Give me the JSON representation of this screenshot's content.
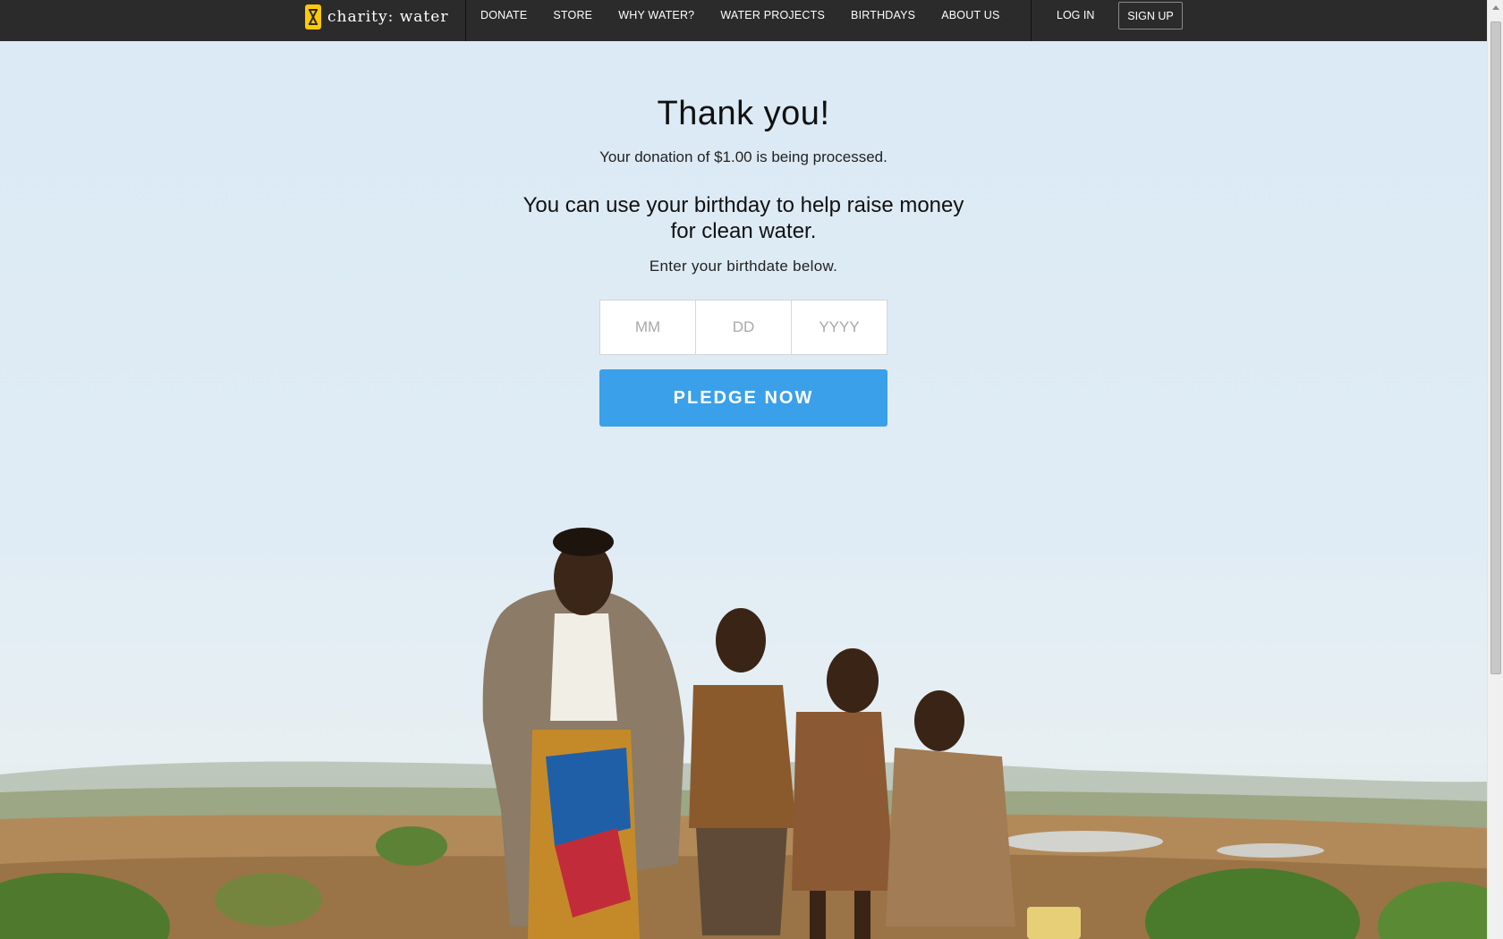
{
  "brand": {
    "name": "charity: water",
    "logo_color": "#ffc907"
  },
  "nav": {
    "items": [
      {
        "label": "DONATE"
      },
      {
        "label": "STORE"
      },
      {
        "label": "WHY WATER?"
      },
      {
        "label": "WATER PROJECTS"
      },
      {
        "label": "BIRTHDAYS"
      },
      {
        "label": "ABOUT US"
      }
    ],
    "login_label": "LOG IN",
    "signup_label": "SIGN UP"
  },
  "main": {
    "title": "Thank you!",
    "subtitle": "Your donation of $1.00 is being processed.",
    "lead": "You can use your birthday to help raise money for clean water.",
    "prompt": "Enter your birthdate below.",
    "birthdate": {
      "month_placeholder": "MM",
      "day_placeholder": "DD",
      "year_placeholder": "YYYY"
    },
    "pledge_label": "PLEDGE NOW"
  },
  "colors": {
    "nav_bg": "#2b2b2b",
    "accent": "#3aa0ea",
    "sky": "#dfedf6"
  },
  "icons": [
    "jerrycan-icon",
    "scrollbar-up-arrow-icon"
  ]
}
